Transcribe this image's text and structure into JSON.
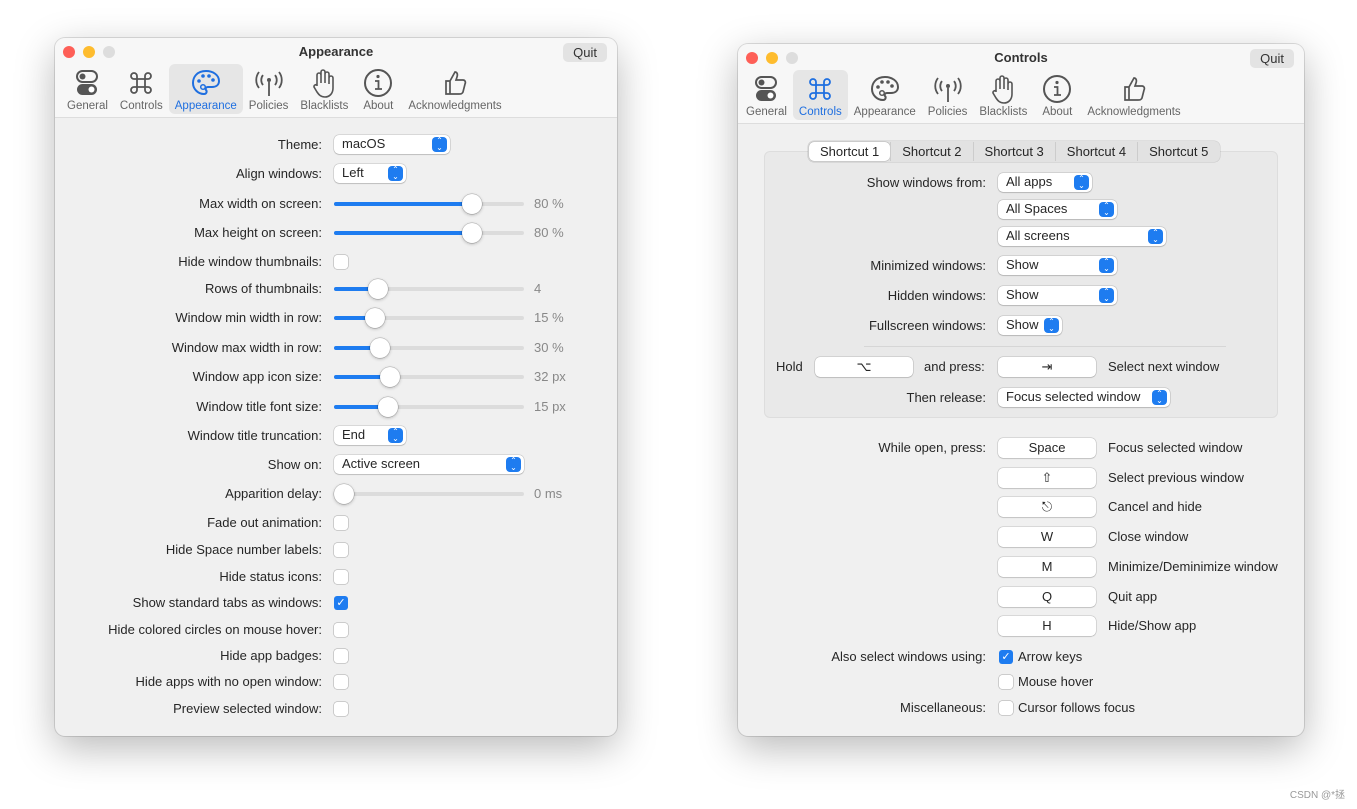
{
  "left": {
    "title": "Appearance",
    "quit": "Quit",
    "tabs": [
      {
        "label": "General",
        "icon": "toggles-icon"
      },
      {
        "label": "Controls",
        "icon": "command-icon"
      },
      {
        "label": "Appearance",
        "icon": "palette-icon",
        "selected": true
      },
      {
        "label": "Policies",
        "icon": "antenna-icon"
      },
      {
        "label": "Blacklists",
        "icon": "hand-icon"
      },
      {
        "label": "About",
        "icon": "info-icon"
      },
      {
        "label": "Acknowledgments",
        "icon": "thumbs-up-icon"
      }
    ],
    "rows": [
      {
        "label": "Theme:",
        "type": "popup",
        "value": " macOS"
      },
      {
        "label": "Align windows:",
        "type": "popup",
        "value": "Left"
      },
      {
        "label": "Max width on screen:",
        "type": "slider",
        "level": 0.75,
        "value": "80 %"
      },
      {
        "label": "Max height on screen:",
        "type": "slider",
        "level": 0.75,
        "value": "80 %"
      },
      {
        "label": "Hide window thumbnails:",
        "type": "checkbox",
        "checked": false
      },
      {
        "label": "Rows of thumbnails:",
        "type": "slider",
        "level": 0.2,
        "value": "4"
      },
      {
        "label": "Window min width in row:",
        "type": "slider",
        "level": 0.18,
        "value": "15 %"
      },
      {
        "label": "Window max width in row:",
        "type": "slider",
        "level": 0.21,
        "value": "30 %"
      },
      {
        "label": "Window app icon size:",
        "type": "slider",
        "level": 0.27,
        "value": "32 px"
      },
      {
        "label": "Window title font size:",
        "type": "slider",
        "level": 0.26,
        "value": "15 px"
      },
      {
        "label": "Window title truncation:",
        "type": "popup",
        "value": "End"
      },
      {
        "label": "Show on:",
        "type": "popup",
        "value": "Active screen"
      },
      {
        "label": "Apparition delay:",
        "type": "slider",
        "level": 0.0,
        "value": "0 ms"
      },
      {
        "label": "Fade out animation:",
        "type": "checkbox",
        "checked": false
      },
      {
        "label": "Hide Space number labels:",
        "type": "checkbox",
        "checked": false
      },
      {
        "label": "Hide status icons:",
        "type": "checkbox",
        "checked": false
      },
      {
        "label": "Show standard tabs as windows:",
        "type": "checkbox",
        "checked": true
      },
      {
        "label": "Hide colored circles on mouse hover:",
        "type": "checkbox",
        "checked": false
      },
      {
        "label": "Hide app badges:",
        "type": "checkbox",
        "checked": false
      },
      {
        "label": "Hide apps with no open window:",
        "type": "checkbox",
        "checked": false
      },
      {
        "label": "Preview selected window:",
        "type": "checkbox",
        "checked": false
      }
    ]
  },
  "right": {
    "title": "Controls",
    "quit": "Quit",
    "tabs": [
      {
        "label": "General",
        "icon": "toggles-icon"
      },
      {
        "label": "Controls",
        "icon": "command-icon",
        "selected": true
      },
      {
        "label": "Appearance",
        "icon": "palette-icon"
      },
      {
        "label": "Policies",
        "icon": "antenna-icon"
      },
      {
        "label": "Blacklists",
        "icon": "hand-icon"
      },
      {
        "label": "About",
        "icon": "info-icon"
      },
      {
        "label": "Acknowledgments",
        "icon": "thumbs-up-icon"
      }
    ],
    "shortcut_tabs": [
      "Shortcut 1",
      "Shortcut 2",
      "Shortcut 3",
      "Shortcut 4",
      "Shortcut 5"
    ],
    "selected_shortcut": 0,
    "show_from_label": "Show windows from:",
    "show_from": [
      "All apps",
      "All Spaces",
      "All screens"
    ],
    "minimized_label": "Minimized windows:",
    "minimized": "Show",
    "hidden_label": "Hidden windows:",
    "hidden": "Show",
    "fullscreen_label": "Fullscreen windows:",
    "fullscreen": "Show",
    "hold_label": "Hold",
    "hold_key": "⌥",
    "and_press_label": "and press:",
    "press_key": "⇥",
    "select_next": "Select next window",
    "then_release_label": "Then release:",
    "then_release": "Focus selected window",
    "while_open_label": "While open, press:",
    "while_open": [
      {
        "key": "Space",
        "action": "Focus selected window"
      },
      {
        "key": "⇧",
        "action": "Select previous window"
      },
      {
        "key": "⎋",
        "action": "Cancel and hide"
      },
      {
        "key": "W",
        "action": "Close window"
      },
      {
        "key": "M",
        "action": "Minimize/Deminimize window"
      },
      {
        "key": "Q",
        "action": "Quit app"
      },
      {
        "key": "H",
        "action": "Hide/Show app"
      }
    ],
    "also_select_label": "Also select windows using:",
    "arrow_keys": {
      "label": "Arrow keys",
      "checked": true
    },
    "mouse_hover": {
      "label": "Mouse hover",
      "checked": false
    },
    "misc_label": "Miscellaneous:",
    "cursor_follows": {
      "label": "Cursor follows focus",
      "checked": false
    }
  },
  "watermark": "CSDN @*拯"
}
